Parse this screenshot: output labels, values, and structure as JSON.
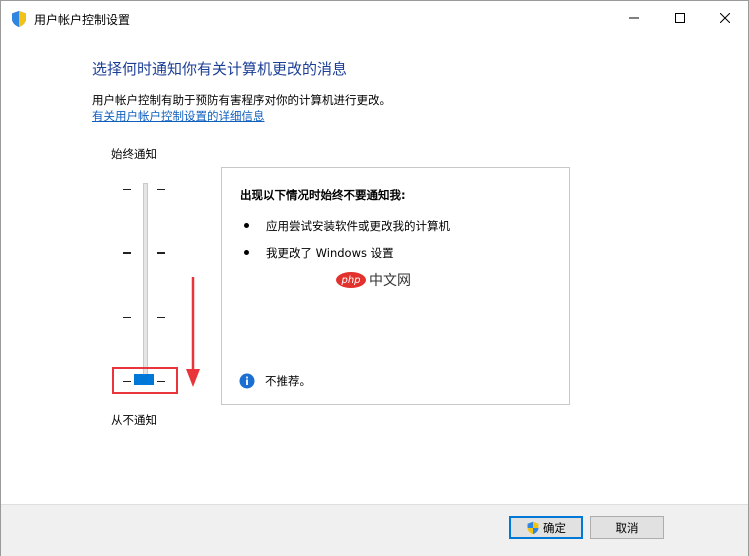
{
  "window": {
    "title": "用户帐户控制设置"
  },
  "header": {
    "heading": "选择何时通知你有关计算机更改的消息",
    "description": "用户帐户控制有助于预防有害程序对你的计算机进行更改。",
    "link": "有关用户帐户控制设置的详细信息"
  },
  "slider": {
    "top_label": "始终通知",
    "bottom_label": "从不通知",
    "levels": 4,
    "selected_level": 1
  },
  "info_panel": {
    "title": "出现以下情况时始终不要通知我:",
    "items": [
      "应用尝试安装软件或更改我的计算机",
      "我更改了 Windows 设置"
    ],
    "note": "不推荐。"
  },
  "watermark": {
    "logo": "php",
    "text": "中文网"
  },
  "footer": {
    "ok_label": "确定",
    "cancel_label": "取消"
  },
  "colors": {
    "heading": "#1c3f96",
    "link": "#0f5fbf",
    "thumb": "#0078d7",
    "highlight": "#e8343a",
    "arrow": "#e8343a",
    "footer_bg": "#f0f0f0"
  }
}
